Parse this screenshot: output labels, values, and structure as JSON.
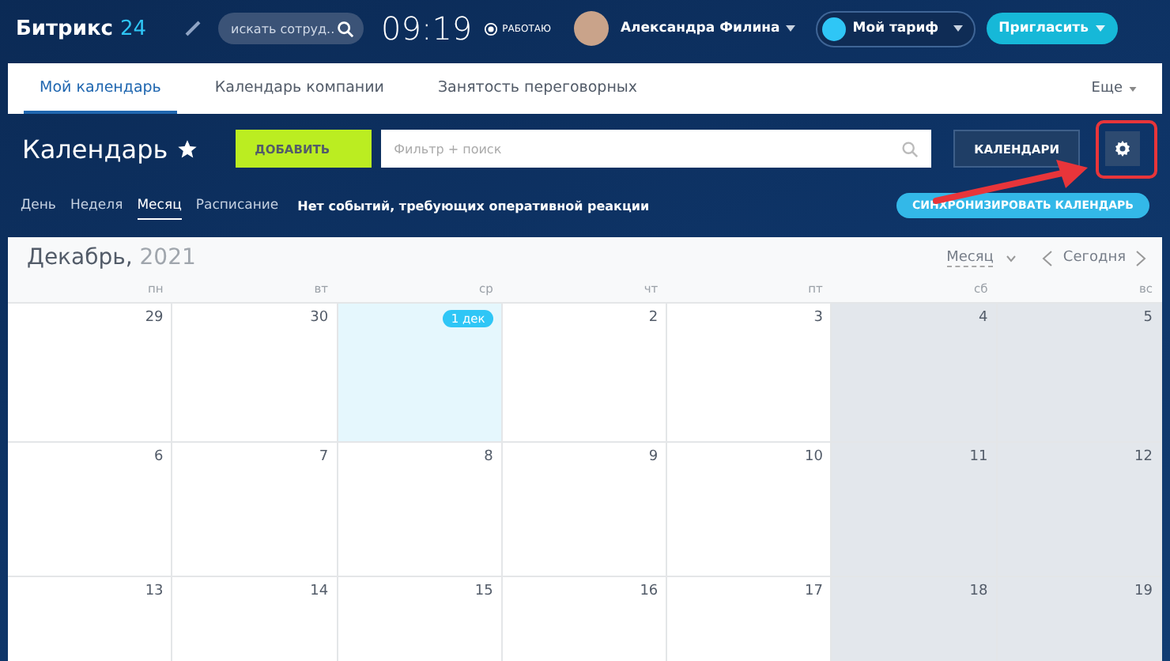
{
  "header": {
    "logo_name": "Битрикс",
    "logo_number": "24",
    "search": {
      "placeholder": "искать сотруд..."
    },
    "clock": "09:19",
    "work_status": "РАБОТАЮ",
    "user_name": "Александра Филина",
    "tariff_button": "Мой тариф",
    "invite_button": "Пригласить"
  },
  "tabs": [
    {
      "label": "Мой календарь",
      "selected": true
    },
    {
      "label": "Календарь компании",
      "selected": false
    },
    {
      "label": "Занятость переговорных",
      "selected": false
    }
  ],
  "more_menu": "Еще",
  "toolbar": {
    "title": "Календарь",
    "add_button": "ДОБАВИТЬ",
    "filter": {
      "placeholder": "Фильтр + поиск"
    },
    "calendars_button": "КАЛЕНДАРИ"
  },
  "view_modes": [
    {
      "label": "День",
      "selected": false
    },
    {
      "label": "Неделя",
      "selected": false
    },
    {
      "label": "Месяц",
      "selected": true
    },
    {
      "label": "Расписание",
      "selected": false
    }
  ],
  "notice": "Нет событий, требующих оперативной реакции",
  "sync_button": "СИНХРОНИЗИРОВАТЬ КАЛЕНДАРЬ",
  "calendar": {
    "month": "Декабрь,",
    "year": "2021",
    "view_select": "Месяц",
    "today_button": "Сегодня",
    "weekdays": [
      "пн",
      "вт",
      "ср",
      "чт",
      "пт",
      "сб",
      "вс"
    ],
    "weeks": [
      [
        {
          "day": "29",
          "today": false,
          "weekend": false
        },
        {
          "day": "30",
          "today": false,
          "weekend": false
        },
        {
          "day": "1 дек",
          "today": true,
          "weekend": false
        },
        {
          "day": "2",
          "today": false,
          "weekend": false
        },
        {
          "day": "3",
          "today": false,
          "weekend": false
        },
        {
          "day": "4",
          "today": false,
          "weekend": true
        },
        {
          "day": "5",
          "today": false,
          "weekend": true
        }
      ],
      [
        {
          "day": "6",
          "today": false,
          "weekend": false
        },
        {
          "day": "7",
          "today": false,
          "weekend": false
        },
        {
          "day": "8",
          "today": false,
          "weekend": false
        },
        {
          "day": "9",
          "today": false,
          "weekend": false
        },
        {
          "day": "10",
          "today": false,
          "weekend": false
        },
        {
          "day": "11",
          "today": false,
          "weekend": true
        },
        {
          "day": "12",
          "today": false,
          "weekend": true
        }
      ],
      [
        {
          "day": "13",
          "today": false,
          "weekend": false
        },
        {
          "day": "14",
          "today": false,
          "weekend": false
        },
        {
          "day": "15",
          "today": false,
          "weekend": false
        },
        {
          "day": "16",
          "today": false,
          "weekend": false
        },
        {
          "day": "17",
          "today": false,
          "weekend": false
        },
        {
          "day": "18",
          "today": false,
          "weekend": true
        },
        {
          "day": "19",
          "today": false,
          "weekend": true
        }
      ]
    ]
  }
}
